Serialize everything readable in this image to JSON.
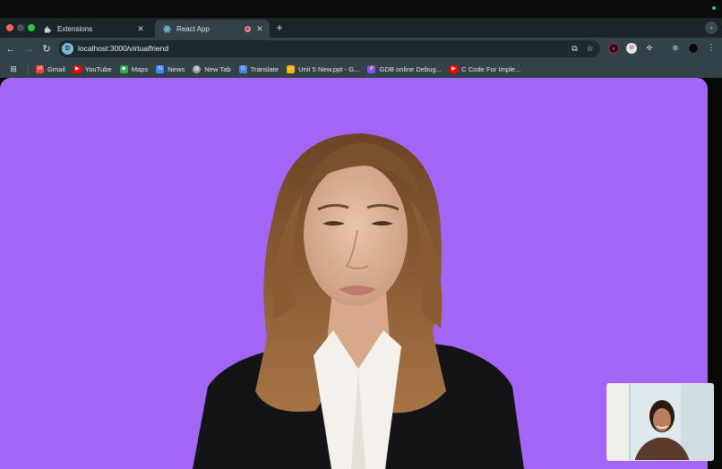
{
  "browser": {
    "tabs": [
      {
        "title": "Extensions",
        "icon": "puzzle-icon",
        "active": false
      },
      {
        "title": "React App",
        "icon": "react-icon",
        "active": true,
        "recording": true
      }
    ],
    "address": {
      "url": "localhost:3000/virtualfriend"
    },
    "bookmarks": [
      {
        "label": "Gmail",
        "icon": "gmail-icon",
        "color": "#ea4335"
      },
      {
        "label": "YouTube",
        "icon": "youtube-icon",
        "color": "#ff0000"
      },
      {
        "label": "Maps",
        "icon": "maps-icon",
        "color": "#34a853"
      },
      {
        "label": "News",
        "icon": "news-icon",
        "color": "#4285f4"
      },
      {
        "label": "New Tab",
        "icon": "globe-icon",
        "color": "#9aa0a6"
      },
      {
        "label": "Translate",
        "icon": "translate-icon",
        "color": "#4285f4"
      },
      {
        "label": "Unit 5 New.ppt - G...",
        "icon": "slides-icon",
        "color": "#f4b400"
      },
      {
        "label": "GDB online Debug...",
        "icon": "lightning-icon",
        "color": "#7c4dff"
      },
      {
        "label": "C Code For Imple...",
        "icon": "youtube-icon",
        "color": "#ff0000"
      }
    ]
  },
  "page": {
    "background": "#a365f5",
    "avatar": "virtual-friend-avatar",
    "webcam": "webcam-preview"
  }
}
